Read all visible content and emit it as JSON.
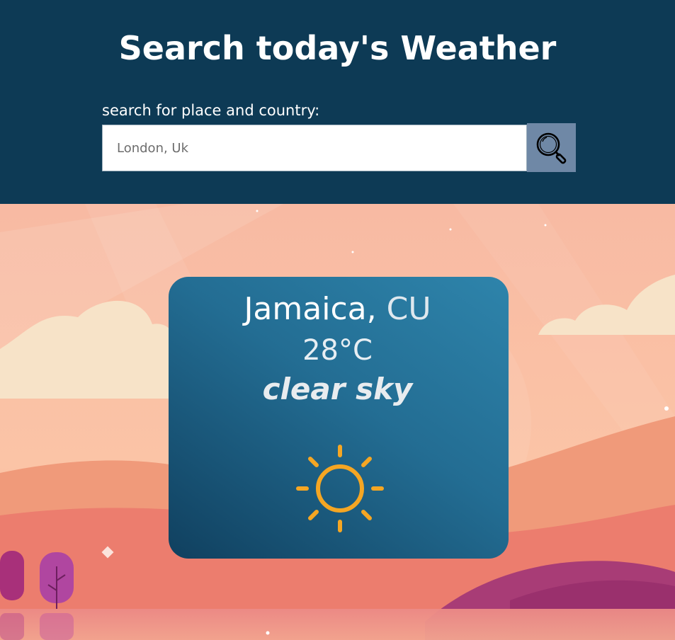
{
  "header": {
    "title": "Search today's Weather",
    "search_label": "search for place and country:",
    "search_placeholder": "London, Uk",
    "search_value": "",
    "search_button_icon": "magnifier-icon"
  },
  "weather": {
    "city": "Jamaica,",
    "country": "CU",
    "temperature": "28°C",
    "description": "clear sky",
    "icon": "sun-icon"
  },
  "colors": {
    "header_bg": "#0d3a55",
    "search_button_bg": "#6f88a6",
    "card_top": "#2e84ab",
    "card_bottom": "#10405f",
    "sun": "#f5a623"
  }
}
